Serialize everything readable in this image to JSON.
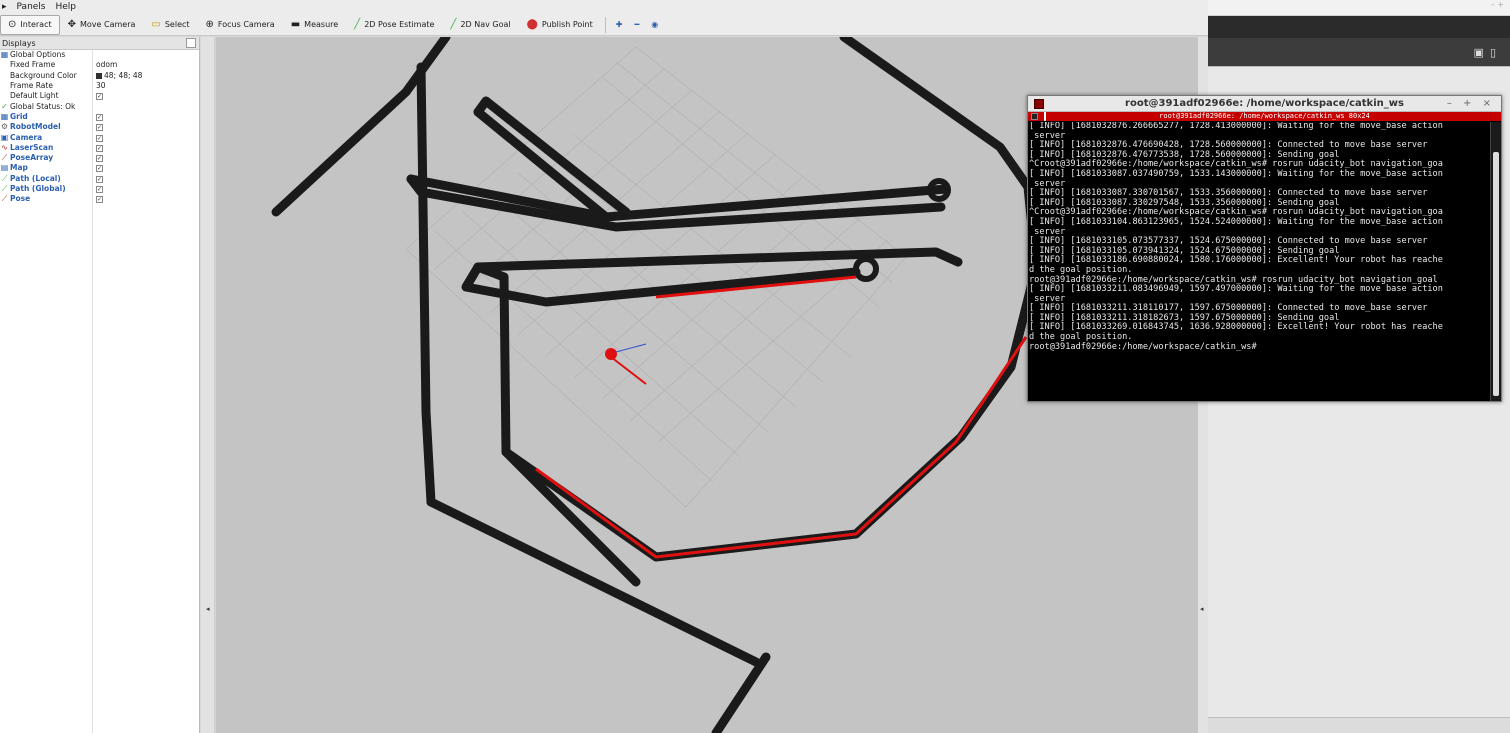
{
  "menu": {
    "panels": "Panels",
    "help": "Help"
  },
  "toolbar": {
    "tools": [
      {
        "icon": "interact-icon",
        "glyph": "⊙",
        "label": "Interact"
      },
      {
        "icon": "move-camera-icon",
        "glyph": "✥",
        "label": "Move Camera"
      },
      {
        "icon": "select-icon",
        "glyph": "▭",
        "label": "Select"
      },
      {
        "icon": "focus-camera-icon",
        "glyph": "⊕",
        "label": "Focus Camera"
      },
      {
        "icon": "measure-icon",
        "glyph": "▬",
        "label": "Measure"
      },
      {
        "icon": "pose-estimate-icon",
        "glyph": "╱",
        "label": "2D Pose Estimate"
      },
      {
        "icon": "nav-goal-icon",
        "glyph": "╱",
        "label": "2D Nav Goal"
      },
      {
        "icon": "publish-point-icon",
        "glyph": "⬤",
        "label": "Publish Point"
      }
    ],
    "colors": {
      "pose": "#3cb43c",
      "nav": "#3cb43c",
      "point": "#d03030"
    }
  },
  "displays": {
    "title": "Displays",
    "global_options": "Global Options",
    "fixed_frame_label": "Fixed Frame",
    "fixed_frame": "odom",
    "bg_color_label": "Background Color",
    "bg_color": "48; 48; 48",
    "frame_rate_label": "Frame Rate",
    "frame_rate": "30",
    "default_light_label": "Default Light",
    "global_status": "Global Status: Ok",
    "items": [
      {
        "name": "Grid",
        "icon": "grid-icon",
        "glyph": "▦",
        "color": "#2a5fb0"
      },
      {
        "name": "RobotModel",
        "icon": "robot-model-icon",
        "glyph": "⚙",
        "color": "#666"
      },
      {
        "name": "Camera",
        "icon": "camera-icon",
        "glyph": "▣",
        "color": "#2a5fb0"
      },
      {
        "name": "LaserScan",
        "icon": "laserscan-icon",
        "glyph": "∿",
        "color": "#c03030"
      },
      {
        "name": "PoseArray",
        "icon": "pose-array-icon",
        "glyph": "⟋",
        "color": "#c03030"
      },
      {
        "name": "Map",
        "icon": "map-icon",
        "glyph": "▤",
        "color": "#2a5fb0"
      },
      {
        "name": "Path (Local)",
        "icon": "path-local-icon",
        "glyph": "⟋",
        "color": "#3cb43c"
      },
      {
        "name": "Path (Global)",
        "icon": "path-global-icon",
        "glyph": "⟋",
        "color": "#3cb43c"
      },
      {
        "name": "Pose",
        "icon": "pose-icon",
        "glyph": "⟋",
        "color": "#c03030"
      }
    ]
  },
  "terminal": {
    "title": "root@391adf02966e: /home/workspace/catkin_ws",
    "tab_label": "root@391adf02966e: /home/workspace/catkin_ws 80x24",
    "lines": [
      "[ INFO] [1681032876.266665277, 1728.413000000]: Waiting for the move_base action",
      " server",
      "[ INFO] [1681032876.476690428, 1728.560000000]: Connected to move base server",
      "[ INFO] [1681032876.476773538, 1728.560000000]: Sending goal",
      "^Croot@391adf02966e:/home/workspace/catkin_ws# rosrun udacity_bot navigation_goa",
      "[ INFO] [1681033087.037490759, 1533.143000000]: Waiting for the move_base action",
      " server",
      "[ INFO] [1681033087.330701567, 1533.356000000]: Connected to move base server",
      "[ INFO] [1681033087.330297548, 1533.356000000]: Sending goal",
      "^Croot@391adf02966e:/home/workspace/catkin_ws# rosrun udacity_bot navigation_goa",
      "[ INFO] [1681033104.863123965, 1524.524000000]: Waiting for the move_base action",
      " server",
      "[ INFO] [1681033105.073577337, 1524.675000000]: Connected to move base server",
      "[ INFO] [1681033105.073941324, 1524.675000000]: Sending goal",
      "[ INFO] [1681033186.690880024, 1580.176000000]: Excellent! Your robot has reache",
      "d the goal position.",
      "root@391adf02966e:/home/workspace/catkin_ws# rosrun udacity_bot navigation_goal",
      "[ INFO] [1681033211.083496949, 1597.497000000]: Waiting for the move base action",
      " server",
      "[ INFO] [1681033211.318110177, 1597.675000000]: Connected to move_base server",
      "[ INFO] [1681033211.318182673, 1597.675000000]: Sending goal",
      "[ INFO] [1681033269.016843745, 1636.928000000]: Excellent! Your robot has reache",
      "d the goal position.",
      "root@391adf02966e:/home/workspace/catkin_ws#"
    ]
  },
  "map_colors": {
    "wall": "#1a1a1a",
    "laser": "#e01010",
    "floor": "#c4c4c4",
    "grid": "#b4b4b4"
  }
}
